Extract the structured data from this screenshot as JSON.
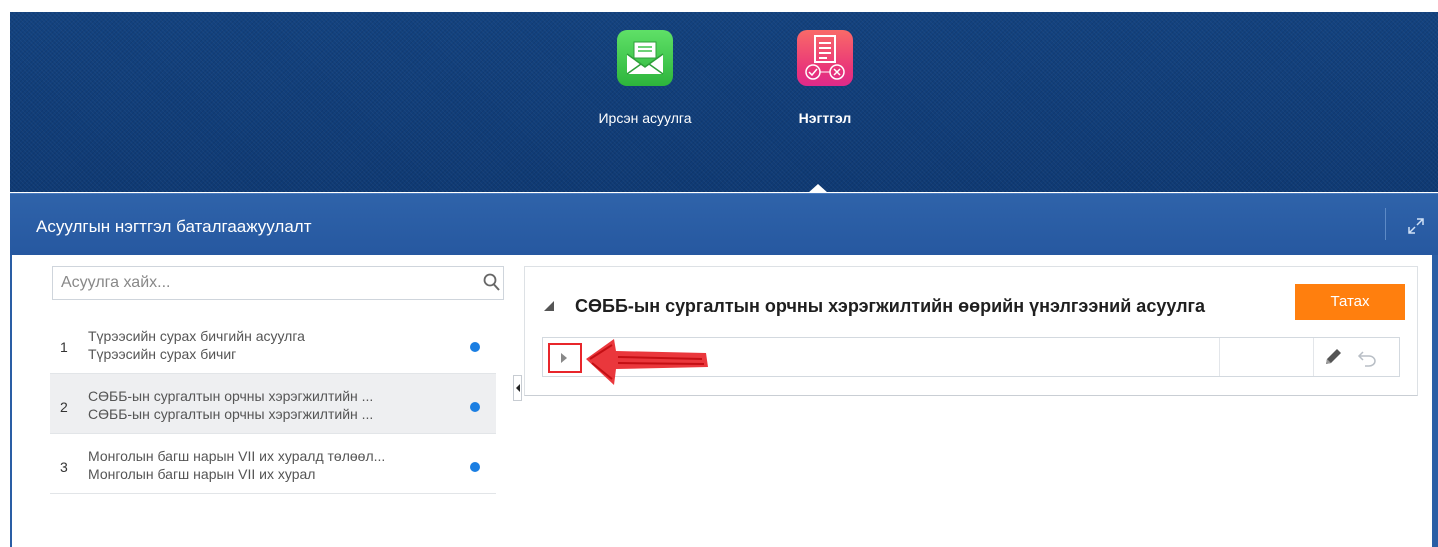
{
  "nav": {
    "tiles": [
      {
        "label": "Ирсэн асуулга",
        "icon": "envelope-icon",
        "active": false
      },
      {
        "label": "Нэгтгэл",
        "icon": "checklist-icon",
        "active": true
      }
    ]
  },
  "page": {
    "title": "Асуулгын нэгтгэл баталгаажуулалт",
    "expand_icon": "expand-icon"
  },
  "search": {
    "placeholder": "Асуулга хайх...",
    "value": "",
    "icon": "search-icon"
  },
  "list": {
    "items": [
      {
        "number": "1",
        "line1": "Түрээсийн сурах бичгийн асуулга",
        "line2": "Түрээсийн сурах бичиг",
        "selected": false
      },
      {
        "number": "2",
        "line1": "СӨББ-ын сургалтын орчны хэрэгжилтийн ...",
        "line2": "СӨББ-ын сургалтын орчны хэрэгжилтийн ...",
        "selected": true
      },
      {
        "number": "3",
        "line1": "Монголын багш нарын VII их хуралд төлөөл...",
        "line2": "Монголын багш нарын VII их хурал",
        "selected": false
      }
    ],
    "dot_color": "#1a7ee2"
  },
  "detail": {
    "title": "СӨББ-ын сургалтын орчны хэрэгжилтийн өөрийн үнэлгээний асуулга",
    "download_label": "Татах",
    "row_icons": [
      "expand-row-icon",
      "pencil-icon",
      "undo-icon"
    ]
  },
  "colors": {
    "header_bg": "#123f7d",
    "title_bar": "#2a5ea5",
    "accent_orange": "#ff7f0e",
    "annotation_red": "#e8262b"
  }
}
